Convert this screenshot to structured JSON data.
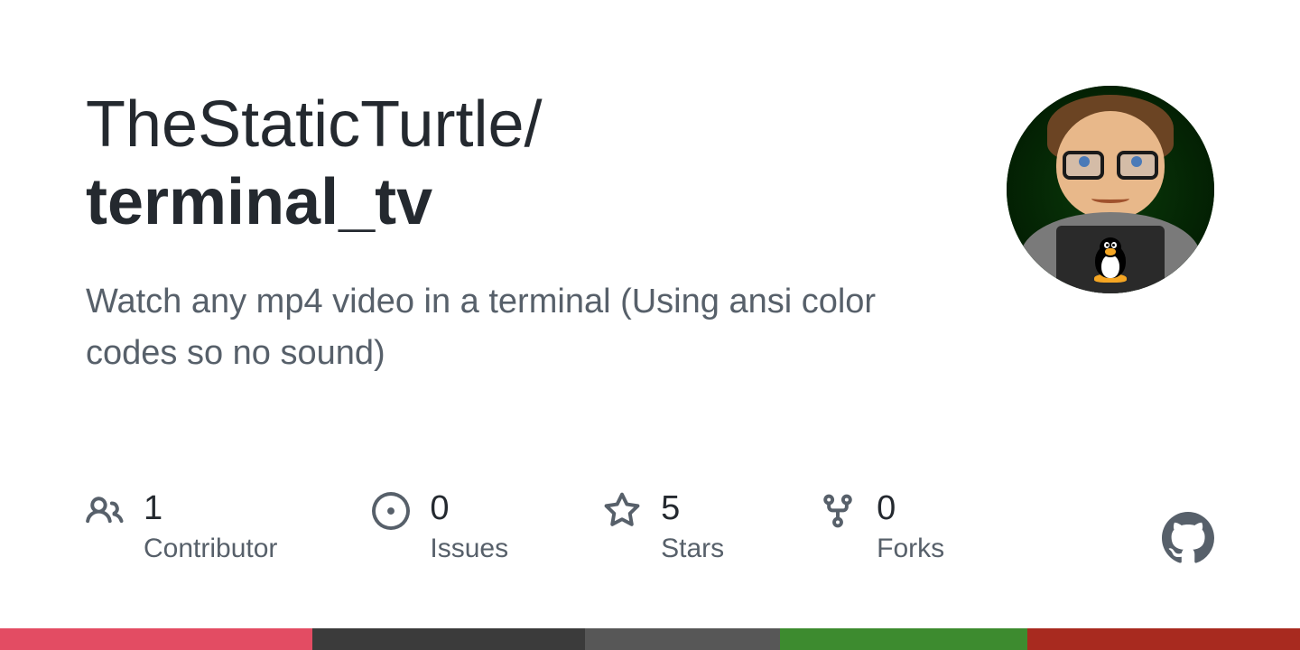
{
  "repo": {
    "owner": "TheStaticTurtle",
    "separator": "/",
    "name": "terminal_tv",
    "description": "Watch any mp4 video in a terminal (Using ansi color codes so no sound)"
  },
  "stats": {
    "contributors": {
      "count": "1",
      "label": "Contributor"
    },
    "issues": {
      "count": "0",
      "label": "Issues"
    },
    "stars": {
      "count": "5",
      "label": "Stars"
    },
    "forks": {
      "count": "0",
      "label": "Forks"
    }
  },
  "languages": [
    {
      "color": "#e34c63",
      "percent": 24
    },
    {
      "color": "#3b3b3b",
      "percent": 21
    },
    {
      "color": "#575757",
      "percent": 15
    },
    {
      "color": "#3d8b2f",
      "percent": 19
    },
    {
      "color": "#a82a1f",
      "percent": 21
    }
  ]
}
